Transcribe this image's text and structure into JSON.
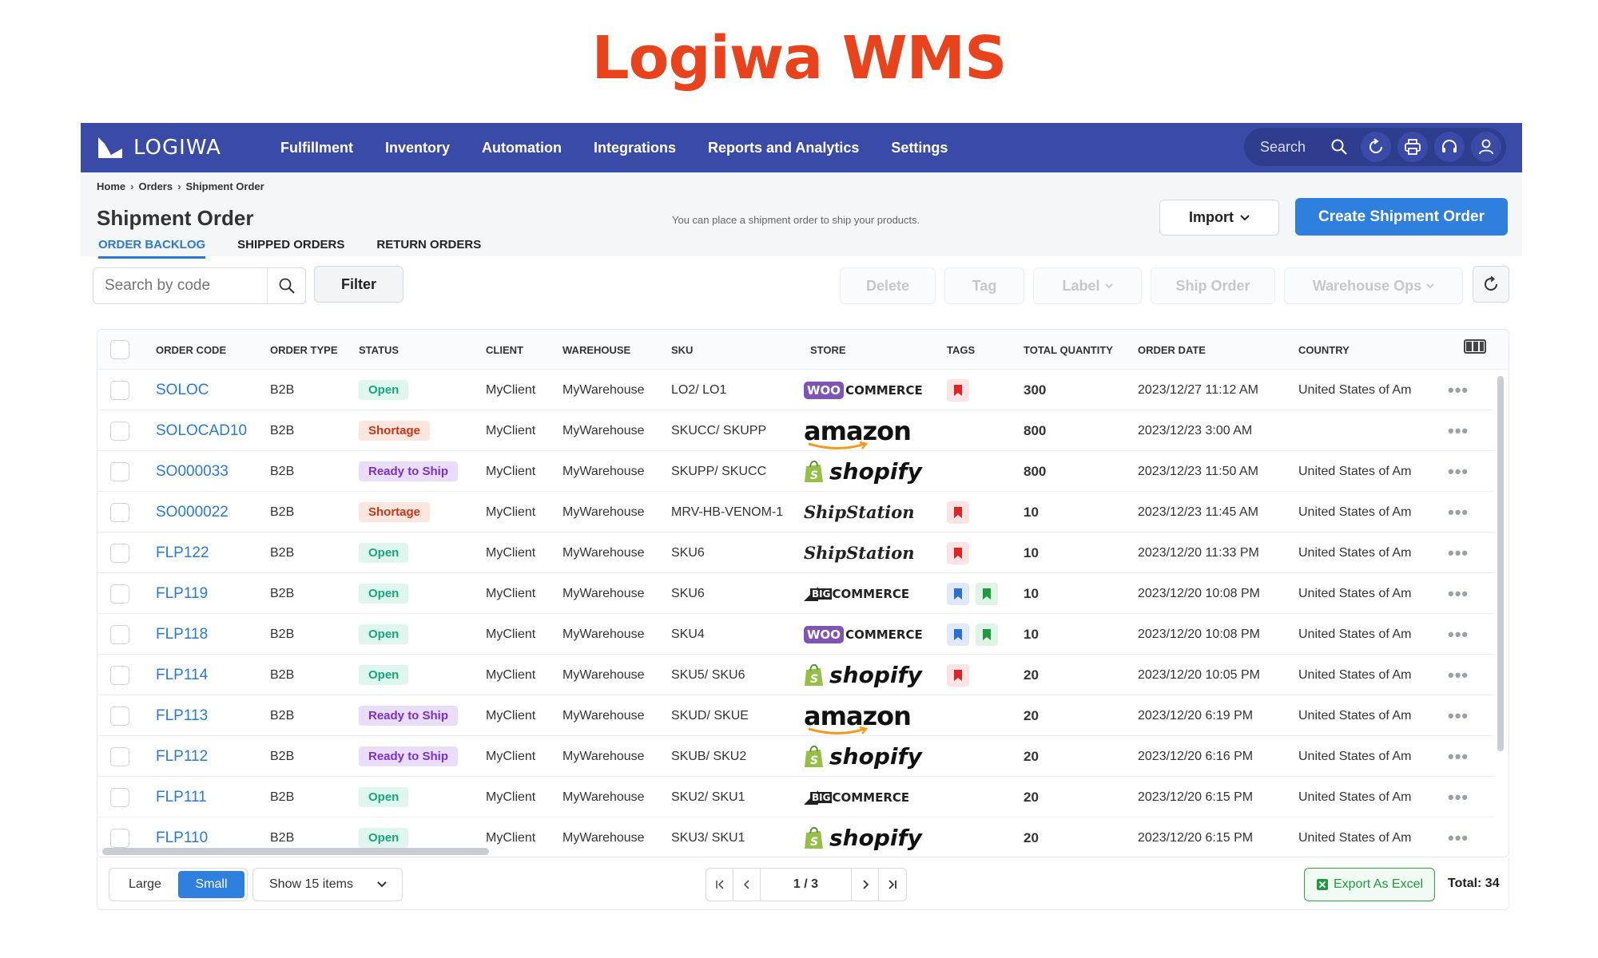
{
  "hero_title": "Logiwa WMS",
  "nav": {
    "logo": "LOGIWA",
    "items": [
      "Fulfillment",
      "Inventory",
      "Automation",
      "Integrations",
      "Reports and Analytics",
      "Settings"
    ],
    "search_label": "Search"
  },
  "breadcrumb": [
    "Home",
    "Orders",
    "Shipment Order"
  ],
  "page": {
    "title": "Shipment Order",
    "hint": "You can place a shipment order to ship your products.",
    "import_label": "Import",
    "create_label": "Create Shipment Order",
    "tabs": [
      "ORDER BACKLOG",
      "SHIPPED ORDERS",
      "RETURN ORDERS"
    ]
  },
  "toolbar": {
    "search_placeholder": "Search by code",
    "filter_label": "Filter",
    "delete_label": "Delete",
    "tag_label": "Tag",
    "label_label": "Label",
    "ship_label": "Ship Order",
    "warehouse_label": "Warehouse Ops"
  },
  "columns": [
    "ORDER CODE",
    "ORDER TYPE",
    "STATUS",
    "CLIENT",
    "WAREHOUSE",
    "SKU",
    "STORE",
    "TAGS",
    "TOTAL QUANTITY",
    "ORDER DATE",
    "COUNTRY"
  ],
  "rows": [
    {
      "code": "SOLOC",
      "type": "B2B",
      "status": "Open",
      "client": "MyClient",
      "warehouse": "MyWarehouse",
      "sku": "LO2/ LO1",
      "store": "woo",
      "tags": [
        "red"
      ],
      "qty": "300",
      "date": "2023/12/27 11:12 AM",
      "country": "United States of Am"
    },
    {
      "code": "SOLOCAD10",
      "type": "B2B",
      "status": "Shortage",
      "client": "MyClient",
      "warehouse": "MyWarehouse",
      "sku": "SKUCC/ SKUPP",
      "store": "amazon",
      "tags": [],
      "qty": "800",
      "date": "2023/12/23 3:00 AM",
      "country": ""
    },
    {
      "code": "SO000033",
      "type": "B2B",
      "status": "Ready to Ship",
      "client": "MyClient",
      "warehouse": "MyWarehouse",
      "sku": "SKUPP/ SKUCC",
      "store": "shopify",
      "tags": [],
      "qty": "800",
      "date": "2023/12/23 11:50 AM",
      "country": "United States of Am"
    },
    {
      "code": "SO000022",
      "type": "B2B",
      "status": "Shortage",
      "client": "MyClient",
      "warehouse": "MyWarehouse",
      "sku": "MRV-HB-VENOM-1",
      "store": "shipstation",
      "tags": [
        "red"
      ],
      "qty": "10",
      "date": "2023/12/23 11:45 AM",
      "country": "United States of Am"
    },
    {
      "code": "FLP122",
      "type": "B2B",
      "status": "Open",
      "client": "MyClient",
      "warehouse": "MyWarehouse",
      "sku": "SKU6",
      "store": "shipstation",
      "tags": [
        "red"
      ],
      "qty": "10",
      "date": "2023/12/20 11:33 PM",
      "country": "United States of Am"
    },
    {
      "code": "FLP119",
      "type": "B2B",
      "status": "Open",
      "client": "MyClient",
      "warehouse": "MyWarehouse",
      "sku": "SKU6",
      "store": "bigcommerce",
      "tags": [
        "blue",
        "green"
      ],
      "qty": "10",
      "date": "2023/12/20 10:08 PM",
      "country": "United States of Am"
    },
    {
      "code": "FLP118",
      "type": "B2B",
      "status": "Open",
      "client": "MyClient",
      "warehouse": "MyWarehouse",
      "sku": "SKU4",
      "store": "woo",
      "tags": [
        "blue",
        "green"
      ],
      "qty": "10",
      "date": "2023/12/20 10:08 PM",
      "country": "United States of Am"
    },
    {
      "code": "FLP114",
      "type": "B2B",
      "status": "Open",
      "client": "MyClient",
      "warehouse": "MyWarehouse",
      "sku": "SKU5/ SKU6",
      "store": "shopify",
      "tags": [
        "red"
      ],
      "qty": "20",
      "date": "2023/12/20 10:05 PM",
      "country": "United States of Am"
    },
    {
      "code": "FLP113",
      "type": "B2B",
      "status": "Ready to Ship",
      "client": "MyClient",
      "warehouse": "MyWarehouse",
      "sku": "SKUD/ SKUE",
      "store": "amazon",
      "tags": [],
      "qty": "20",
      "date": "2023/12/20 6:19 PM",
      "country": "United States of Am"
    },
    {
      "code": "FLP112",
      "type": "B2B",
      "status": "Ready to Ship",
      "client": "MyClient",
      "warehouse": "MyWarehouse",
      "sku": "SKUB/ SKU2",
      "store": "shopify",
      "tags": [],
      "qty": "20",
      "date": "2023/12/20 6:16 PM",
      "country": "United States of Am"
    },
    {
      "code": "FLP111",
      "type": "B2B",
      "status": "Open",
      "client": "MyClient",
      "warehouse": "MyWarehouse",
      "sku": "SKU2/ SKU1",
      "store": "bigcommerce",
      "tags": [],
      "qty": "20",
      "date": "2023/12/20 6:15 PM",
      "country": "United States of Am"
    },
    {
      "code": "FLP110",
      "type": "B2B",
      "status": "Open",
      "client": "MyClient",
      "warehouse": "MyWarehouse",
      "sku": "SKU3/ SKU1",
      "store": "shopify",
      "tags": [],
      "qty": "20",
      "date": "2023/12/20 6:15 PM",
      "country": "United States of Am"
    }
  ],
  "store_text": {
    "woo_a": "WOO",
    "woo_b": "COMMERCE",
    "amazon": "amazon",
    "shopify": "shopify",
    "shipstation": "ShipStation",
    "big_a": "BIG",
    "big_b": "COMMERCE"
  },
  "more_glyph": "•••",
  "footer": {
    "size_large": "Large",
    "size_small": "Small",
    "show_items": "Show 15 items",
    "page": "1 / 3",
    "export_label": "Export As Excel",
    "total": "Total: 34"
  },
  "colors": {
    "brand": "#e8431c",
    "nav": "#3a4aa7",
    "primary": "#2f7fde",
    "link": "#2a7ad4"
  }
}
